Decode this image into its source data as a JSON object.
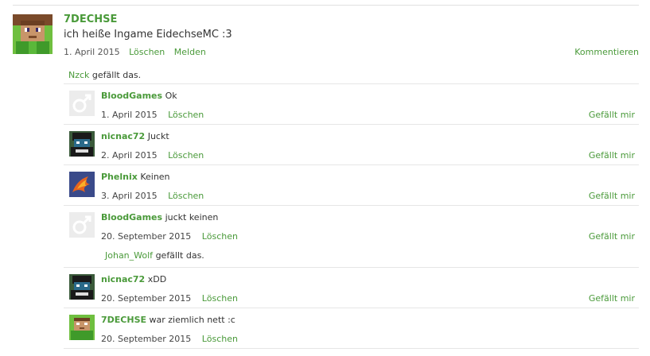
{
  "post": {
    "username": "7DECHSE",
    "text": "ich heiße Ingame EidechseMC :3",
    "date": "1. April 2015",
    "delete_label": "Löschen",
    "report_label": "Melden",
    "comment_label": "Kommentieren",
    "likes": {
      "user": "Nzck",
      "suffix": "gefällt das."
    }
  },
  "comments": [
    {
      "username": "BloodGames",
      "text": "Ok",
      "date": "1. April 2015",
      "delete_label": "Löschen",
      "like_label": "Gefällt mir",
      "avatar": "male-placeholder-icon"
    },
    {
      "username": "nicnac72",
      "text": "Juckt",
      "date": "2. April 2015",
      "delete_label": "Löschen",
      "like_label": "Gefällt mir",
      "avatar": "minecraft-skin-avatar"
    },
    {
      "username": "Phelnix",
      "text": "Keinen",
      "date": "3. April 2015",
      "delete_label": "Löschen",
      "like_label": "Gefällt mir",
      "avatar": "phoenix-avatar"
    },
    {
      "username": "BloodGames",
      "text": "juckt keinen",
      "date": "20. September 2015",
      "delete_label": "Löschen",
      "like_label": "Gefällt mir",
      "avatar": "male-placeholder-icon",
      "likes": {
        "user": "Johan_Wolf",
        "suffix": "gefällt das."
      }
    },
    {
      "username": "nicnac72",
      "text": "xDD",
      "date": "20. September 2015",
      "delete_label": "Löschen",
      "like_label": "Gefällt mir",
      "avatar": "minecraft-skin-avatar"
    },
    {
      "username": "7DECHSE",
      "text": "war ziemlich nett :c",
      "date": "20. September 2015",
      "delete_label": "Löschen",
      "avatar": "minecraft-green-avatar"
    }
  ],
  "colors": {
    "link": "#4a9a3a",
    "separator": "#e6e6e6"
  }
}
